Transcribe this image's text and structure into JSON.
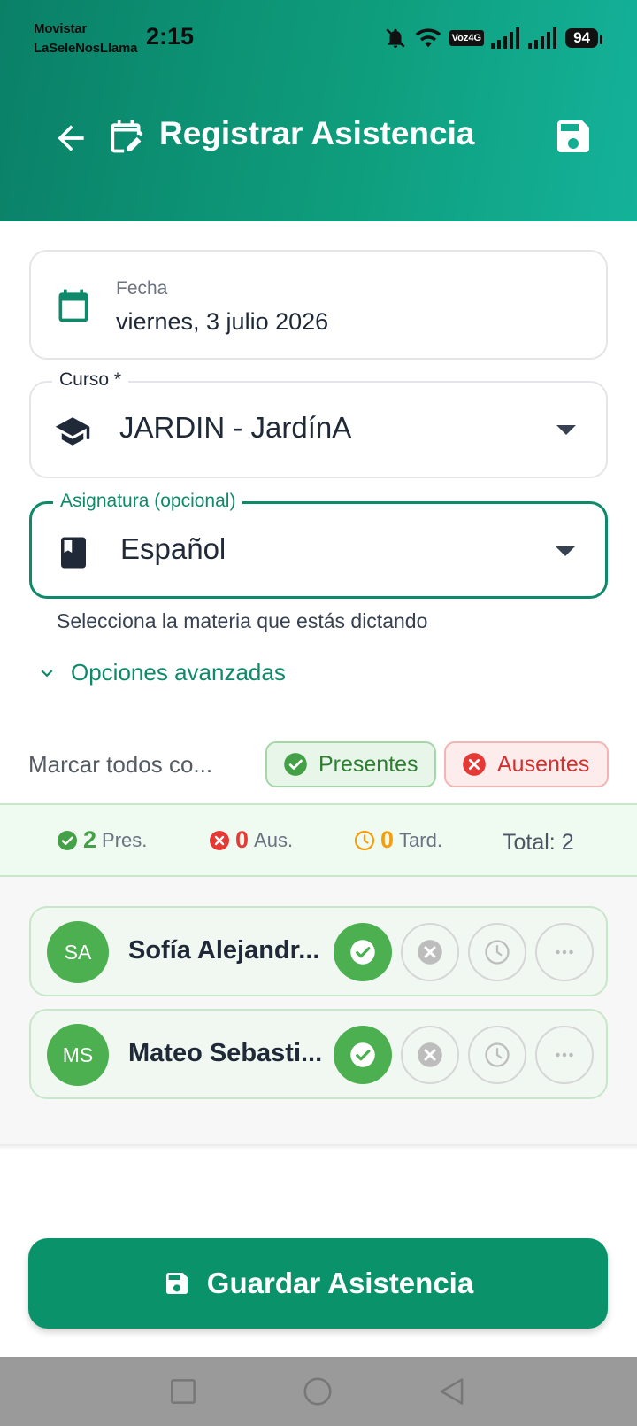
{
  "status_bar": {
    "carrier_line1": "Movistar",
    "carrier_line2": "LaSeleNosLlama",
    "time": "2:15",
    "volte_badge": "Voz4G",
    "battery": "94"
  },
  "toolbar": {
    "title": "Registrar Asistencia",
    "back_icon": "arrow-left-icon",
    "title_icon": "calendar-edit-icon",
    "save_icon": "floppy-disk-icon"
  },
  "date": {
    "label": "Fecha",
    "value": "viernes, 3 julio 2026",
    "icon": "calendar-icon"
  },
  "curso": {
    "label": "Curso *",
    "value": "JARDIN - JardínA",
    "icon": "graduation-cap-icon"
  },
  "asignatura": {
    "label": "Asignatura (opcional)",
    "value": "Español",
    "helper": "Selecciona la materia que estás dictando",
    "icon": "book-icon"
  },
  "advanced": {
    "label": "Opciones avanzadas"
  },
  "mark_all": {
    "label": "Marcar todos co...",
    "present_label": "Presentes",
    "absent_label": "Ausentes"
  },
  "summary": {
    "present_count": "2",
    "present_label": "Pres.",
    "absent_count": "0",
    "absent_label": "Aus.",
    "late_count": "0",
    "late_label": "Tard.",
    "total": "Total: 2"
  },
  "students": [
    {
      "initials": "SA",
      "name": "Sofía Alejandr...",
      "status": "present"
    },
    {
      "initials": "MS",
      "name": "Mateo Sebasti...",
      "status": "present"
    }
  ],
  "save_button": {
    "label": "Guardar Asistencia"
  },
  "colors": {
    "brand": "#0a936b",
    "present": "#4caf50",
    "absent": "#e53935",
    "late": "#f59e0b"
  }
}
